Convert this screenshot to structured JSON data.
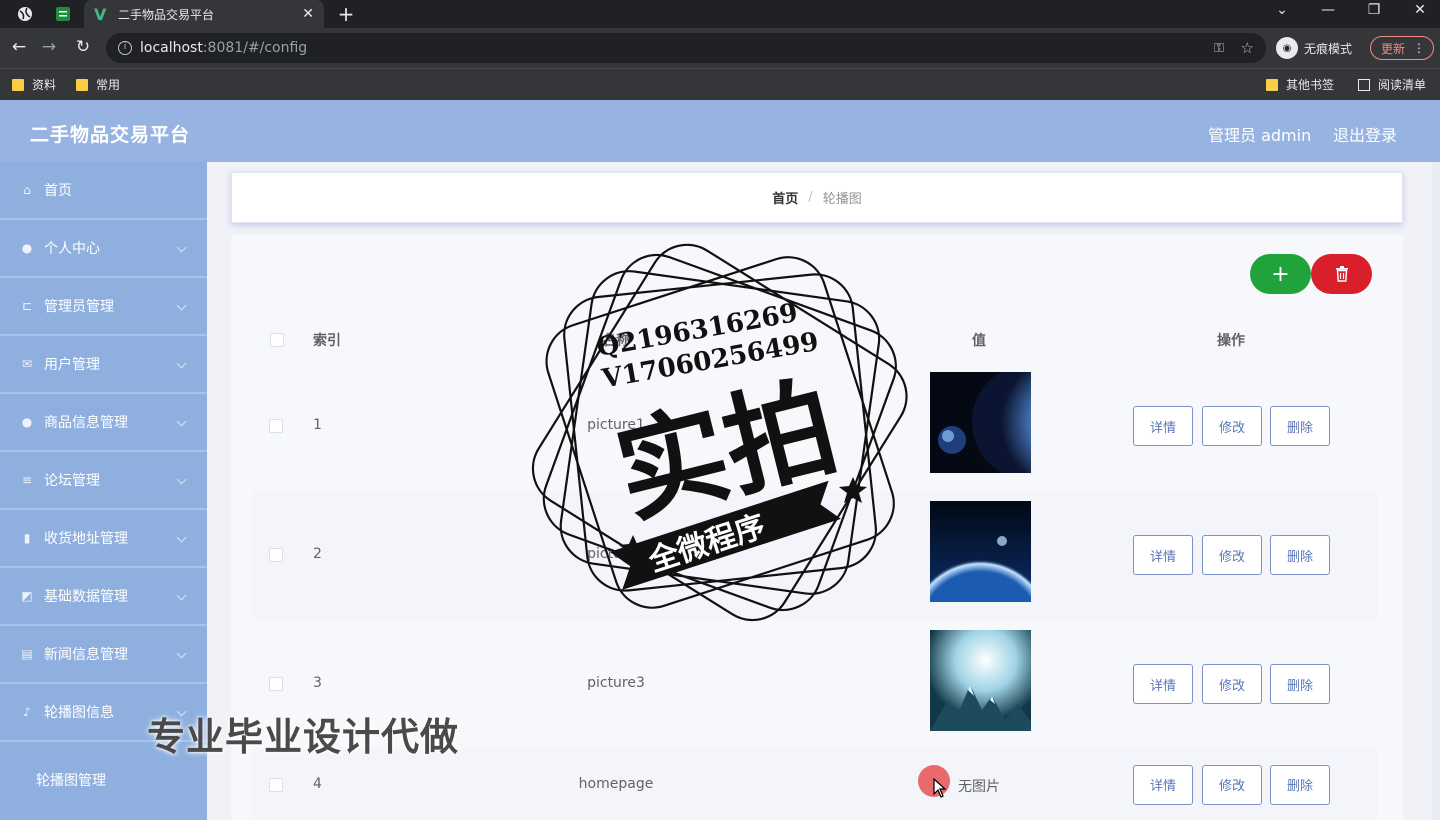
{
  "browser": {
    "tab_title": "二手物品交易平台",
    "url_host": "localhost",
    "url_rest": ":8081/#/config",
    "incognito_label": "无痕模式",
    "update_label": "更新",
    "bookmarks": [
      "资料",
      "常用"
    ],
    "bookmarks_right": [
      "其他书签",
      "阅读清单"
    ]
  },
  "header": {
    "title": "二手物品交易平台",
    "user": "管理员 admin",
    "logout": "退出登录"
  },
  "sidebar": {
    "items": [
      {
        "label": "首页",
        "icon": "home-icon",
        "glyph": "⌂",
        "has_arrow": false
      },
      {
        "label": "个人中心",
        "icon": "user-icon",
        "glyph": "●",
        "has_arrow": true
      },
      {
        "label": "管理员管理",
        "icon": "crop-icon",
        "glyph": "⊏",
        "has_arrow": true
      },
      {
        "label": "用户管理",
        "icon": "users-icon",
        "glyph": "✉",
        "has_arrow": true
      },
      {
        "label": "商品信息管理",
        "icon": "person-icon",
        "glyph": "●",
        "has_arrow": true
      },
      {
        "label": "论坛管理",
        "icon": "list-icon",
        "glyph": "≡",
        "has_arrow": true
      },
      {
        "label": "收货地址管理",
        "icon": "chart-icon",
        "glyph": "▮",
        "has_arrow": true
      },
      {
        "label": "基础数据管理",
        "icon": "data-icon",
        "glyph": "◩",
        "has_arrow": true
      },
      {
        "label": "新闻信息管理",
        "icon": "news-icon",
        "glyph": "▤",
        "has_arrow": true
      },
      {
        "label": "轮播图信息",
        "icon": "mic-icon",
        "glyph": "♪",
        "has_arrow": true
      }
    ],
    "sub_item": "轮播图管理"
  },
  "breadcrumb": {
    "home": "首页",
    "separator": "/",
    "current": "轮播图"
  },
  "table": {
    "headers": {
      "index": "索引",
      "name": "名称",
      "value": "值",
      "actions": "操作"
    },
    "rows": [
      {
        "index": "1",
        "name": "picture1",
        "image": "planet-blue"
      },
      {
        "index": "2",
        "name": "picture2",
        "image": "earth-horizon"
      },
      {
        "index": "3",
        "name": "picture3",
        "image": "ice-peaks"
      },
      {
        "index": "4",
        "name": "homepage",
        "image": "none"
      }
    ],
    "no_image_text": "无图片",
    "actions": {
      "detail": "详情",
      "edit": "修改",
      "delete": "删除"
    }
  },
  "toolbar": {
    "add_glyph": "+",
    "delete_glyph": "🗑"
  },
  "watermark": {
    "qq": "Q2196316269",
    "vx": "V17060256499",
    "main": "实拍",
    "ribbon": "全微程序",
    "promo": "专业毕业设计代做"
  }
}
